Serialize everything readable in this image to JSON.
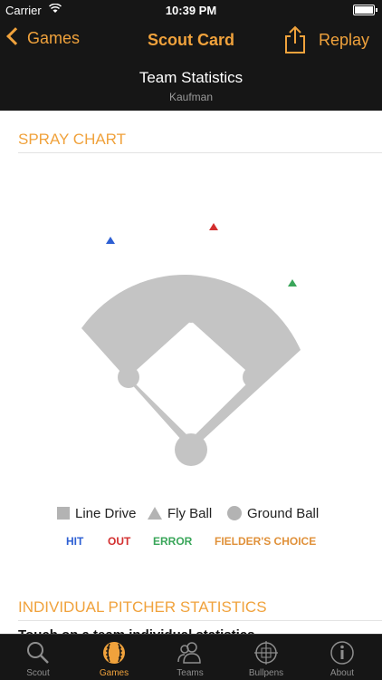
{
  "status": {
    "carrier": "Carrier",
    "time": "10:39 PM"
  },
  "nav": {
    "back_label": "Games",
    "title": "Scout Card",
    "replay_label": "Replay"
  },
  "header": {
    "title": "Team Statistics",
    "subtitle": "Kaufman"
  },
  "spray_chart": {
    "section_title": "SPRAY CHART",
    "field_color": "#c4c4c4",
    "markers": [
      {
        "type": "fly-ball",
        "result": "hit",
        "color": "#2d5fd3"
      },
      {
        "type": "fly-ball",
        "result": "out",
        "color": "#d32f2f"
      },
      {
        "type": "fly-ball",
        "result": "error",
        "color": "#3aa65a"
      }
    ]
  },
  "legend": {
    "line_drive": "Line Drive",
    "fly_ball": "Fly Ball",
    "ground_ball": "Ground Ball"
  },
  "outcomes": {
    "hit": "HIT",
    "out": "OUT",
    "error": "ERROR",
    "fielders_choice": "FIELDER'S CHOICE",
    "colors": {
      "hit": "#2d5fd3",
      "out": "#d32f2f",
      "error": "#3aa65a",
      "fielders_choice": "#e0913a"
    }
  },
  "pitcher_section": {
    "title": "INDIVIDUAL PITCHER STATISTICS",
    "peek_text": "Touch on a team individual statistics"
  },
  "tabs": [
    {
      "label": "Scout",
      "icon": "search-icon",
      "active": false
    },
    {
      "label": "Games",
      "icon": "baseball-icon",
      "active": true
    },
    {
      "label": "Teams",
      "icon": "people-icon",
      "active": false
    },
    {
      "label": "Bullpens",
      "icon": "crosshair-icon",
      "active": false
    },
    {
      "label": "About",
      "icon": "info-icon",
      "active": false
    }
  ],
  "colors": {
    "accent": "#f0a23c",
    "bar_background": "#161616"
  }
}
